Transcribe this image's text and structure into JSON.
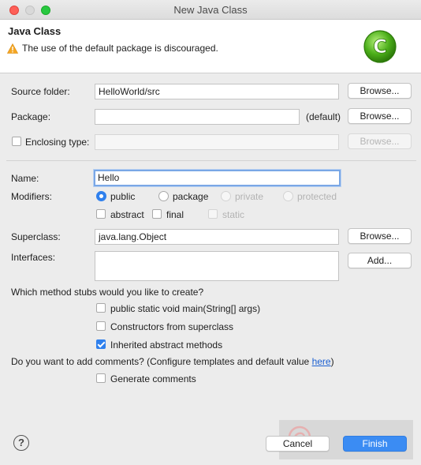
{
  "window": {
    "title": "New Java Class"
  },
  "header": {
    "title": "Java Class",
    "warning": "The use of the default package is discouraged.",
    "badge_letter": "C"
  },
  "form": {
    "source_folder": {
      "label": "Source folder:",
      "value": "HelloWorld/src",
      "button": "Browse..."
    },
    "package": {
      "label": "Package:",
      "value": "",
      "hint": "(default)",
      "button": "Browse..."
    },
    "enclosing_type": {
      "label": "Enclosing type:",
      "checked": false,
      "value": "",
      "button": "Browse..."
    },
    "name": {
      "label": "Name:",
      "value": "Hello"
    },
    "modifiers": {
      "label": "Modifiers:",
      "access": [
        "public",
        "package",
        "private",
        "protected"
      ],
      "selected": "public",
      "extra": [
        "abstract",
        "final",
        "static"
      ]
    },
    "superclass": {
      "label": "Superclass:",
      "value": "java.lang.Object",
      "button": "Browse..."
    },
    "interfaces": {
      "label": "Interfaces:",
      "button": "Add..."
    },
    "stubs": {
      "question": "Which method stubs would you like to create?",
      "options": [
        {
          "label": "public static void main(String[] args)",
          "checked": false
        },
        {
          "label": "Constructors from superclass",
          "checked": false
        },
        {
          "label": "Inherited abstract methods",
          "checked": true
        }
      ]
    },
    "comments": {
      "question_prefix": "Do you want to add comments? (Configure templates and default value ",
      "link": "here",
      "question_suffix": ")",
      "option": "Generate comments",
      "checked": false
    }
  },
  "footer": {
    "help": "?",
    "cancel": "Cancel",
    "finish": "Finish"
  },
  "colors": {
    "accent": "#2f80ed",
    "warning": "#f5a623",
    "badge_green": "#4caf1a"
  }
}
